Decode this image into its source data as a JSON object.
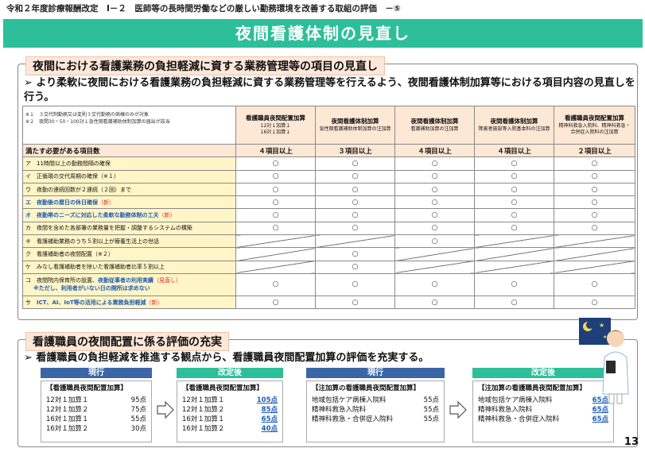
{
  "header": {
    "line": "令和２年度診療報酬改定　Ⅰ－２　医師等の長時間労働などの厳しい勤務環境を改善する取組の評価　－⑤",
    "title": "夜間看護体制の見直し"
  },
  "section1": {
    "label": "夜間における看護業務の負担軽減に資する業務管理等の項目の見直し",
    "bullet": "より柔軟に夜間における看護業務の負担軽減に資する業務管理等を行えるよう、夜間看護体制加算等における項目内容の見直しを行う。",
    "notes": [
      "※１　３交代制勤務又は変則３交代勤務の病棟のみが対象",
      "※２　夜間30・50・100対１急性期看護補助体制加算の届出が該当"
    ],
    "columns": [
      {
        "title": "看護職員夜間配置加算",
        "sub": "12対１加算１\n16対１加算１"
      },
      {
        "title": "夜間看護体制加算",
        "sub": "急性期看護補助体制加算の注加算"
      },
      {
        "title": "夜間看護体制加算",
        "sub": "看護補助加算の注加算"
      },
      {
        "title": "夜間看護体制加算",
        "sub": "障害者施設等入院基本料の注加算"
      },
      {
        "title": "看護職員夜間配置加算",
        "sub": "精神科救急入院料、精神科救急・合併症入院料の注加算"
      }
    ],
    "required_label": "満たす必要がある項目数",
    "required": [
      "４項目以上",
      "３項目以上",
      "４項目以上",
      "４項目以上",
      "２項目以上"
    ],
    "circle": "○",
    "rows": [
      {
        "text": "ア　11時間以上の勤務間隔の確保",
        "marks": [
          1,
          1,
          1,
          1,
          1
        ]
      },
      {
        "text": "イ　正循環の交代周期の確保（※１）",
        "marks": [
          1,
          1,
          1,
          1,
          1
        ]
      },
      {
        "text": "ウ　夜勤の連続回数が２連続（２回）まで",
        "marks": [
          1,
          1,
          1,
          1,
          1
        ]
      },
      {
        "text": "エ　夜勤後の暦日の休日確保",
        "new": "（新）",
        "marks": [
          1,
          1,
          1,
          1,
          1
        ]
      },
      {
        "text": "オ　夜勤帯のニーズに対応した柔軟な勤務体制の工夫",
        "new": "（新）",
        "marks": [
          1,
          1,
          1,
          1,
          1
        ]
      },
      {
        "text": "カ　夜間を含めた各部署の業務量を把握・調整するシステムの構築",
        "marks": [
          1,
          1,
          1,
          1,
          1
        ]
      },
      {
        "text": "キ　看護補助業務のうち５割以上が療養生活上の世話",
        "marks": [
          0,
          0,
          1,
          0,
          0
        ]
      },
      {
        "text": "ク　看護補助者の夜間配置（※２）",
        "marks": [
          0,
          1,
          0,
          0,
          0
        ]
      },
      {
        "text": "ケ　みなし看護補助者を除いた看護補助者比率５割以上",
        "marks": [
          0,
          1,
          0,
          0,
          0
        ]
      },
      {
        "text": "コ　夜間院内保育所の設置、",
        "hl": "夜勤従事者の利用実績",
        "mid": "（見直し）",
        "hl2": "※ただし、利用者がいない日の開所は求めない",
        "marks": [
          1,
          1,
          1,
          1,
          1
        ]
      },
      {
        "text": "サ　",
        "hl": "ICT、AI、IoT等の活用による業務負担軽減",
        "new": "（新）",
        "marks": [
          1,
          1,
          1,
          1,
          1
        ]
      }
    ]
  },
  "section2": {
    "label": "看護職員の夜間配置に係る評価の充実",
    "bullet": "看護職員の負担軽減を推進する観点から、看護職員夜間配置加算の評価を充実する。",
    "panels": [
      {
        "head": "現行",
        "title": "【看護職員夜間配置加算】",
        "rows": [
          [
            "12対１加算１",
            "95点"
          ],
          [
            "12対１加算２",
            "75点"
          ],
          [
            "16対１加算１",
            "55点"
          ],
          [
            "16対１加算２",
            "30点"
          ]
        ]
      },
      {
        "head": "改定後",
        "title": "【看護職員夜間配置加算】",
        "rows": [
          [
            "12対１加算１",
            "105点"
          ],
          [
            "12対１加算２",
            "85点"
          ],
          [
            "16対１加算１",
            "65点"
          ],
          [
            "16対１加算２",
            "40点"
          ]
        ]
      },
      {
        "head": "現行",
        "title": "【注加算の看護職員夜間配置加算】",
        "rows": [
          [
            "地域包括ケア病棟入院料",
            "55点"
          ],
          [
            "精神科救急入院料",
            "55点"
          ],
          [
            "精神科救急・合併症入院料",
            "55点"
          ]
        ]
      },
      {
        "head": "改定後",
        "title": "【注加算の看護職員夜間配置加算】",
        "rows": [
          [
            "地域包括ケア病棟入院料",
            "65点"
          ],
          [
            "精神科救急入院料",
            "65点"
          ],
          [
            "精神科救急・合併症入院料",
            "65点"
          ]
        ]
      }
    ]
  },
  "page_number": "13",
  "colors": {
    "accent": "#2dbf9a",
    "blue": "#3b66a6",
    "highlight": "#1c5cb8",
    "new": "#e22233"
  }
}
